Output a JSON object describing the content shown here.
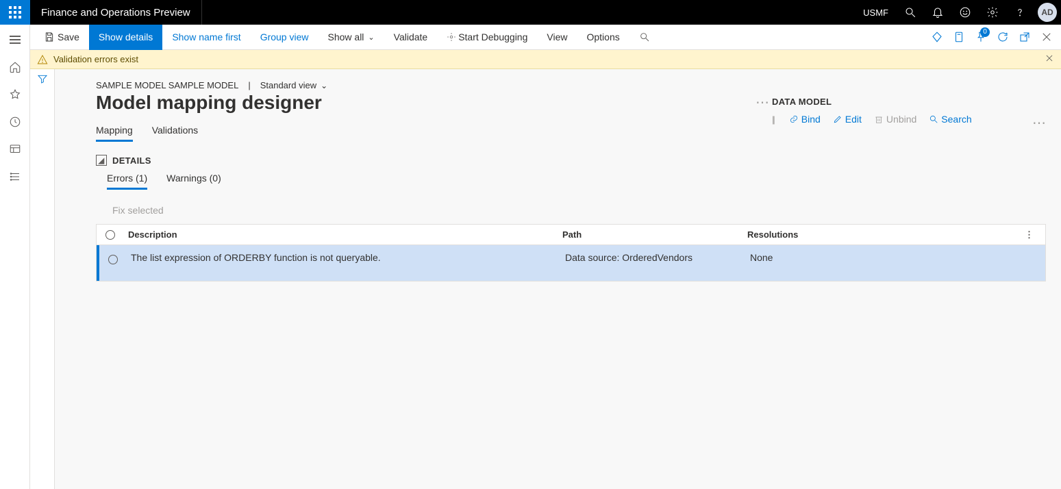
{
  "titlebar": {
    "app_name": "Finance and Operations Preview",
    "company": "USMF",
    "avatar_initials": "AD"
  },
  "actionbar": {
    "save": "Save",
    "show_details": "Show details",
    "show_name_first": "Show name first",
    "group_view": "Group view",
    "show_all": "Show all",
    "validate": "Validate",
    "start_debugging": "Start Debugging",
    "view": "View",
    "options": "Options",
    "attachment_badge": "0"
  },
  "warning": {
    "text": "Validation errors exist"
  },
  "page": {
    "breadcrumb": "SAMPLE MODEL SAMPLE MODEL",
    "view_name": "Standard view",
    "title": "Model mapping designer"
  },
  "tabs": {
    "mapping": "Mapping",
    "validations": "Validations"
  },
  "details": {
    "heading": "DETAILS",
    "errors_tab": "Errors (1)",
    "warnings_tab": "Warnings (0)",
    "fix_selected": "Fix selected"
  },
  "grid": {
    "head": {
      "description": "Description",
      "path": "Path",
      "resolutions": "Resolutions"
    },
    "row": {
      "description": "The list expression of ORDERBY function is not queryable.",
      "path": "Data source: OrderedVendors",
      "resolutions": "None"
    }
  },
  "right_panel": {
    "title": "DATA MODEL",
    "bind": "Bind",
    "edit": "Edit",
    "unbind": "Unbind",
    "search": "Search"
  }
}
